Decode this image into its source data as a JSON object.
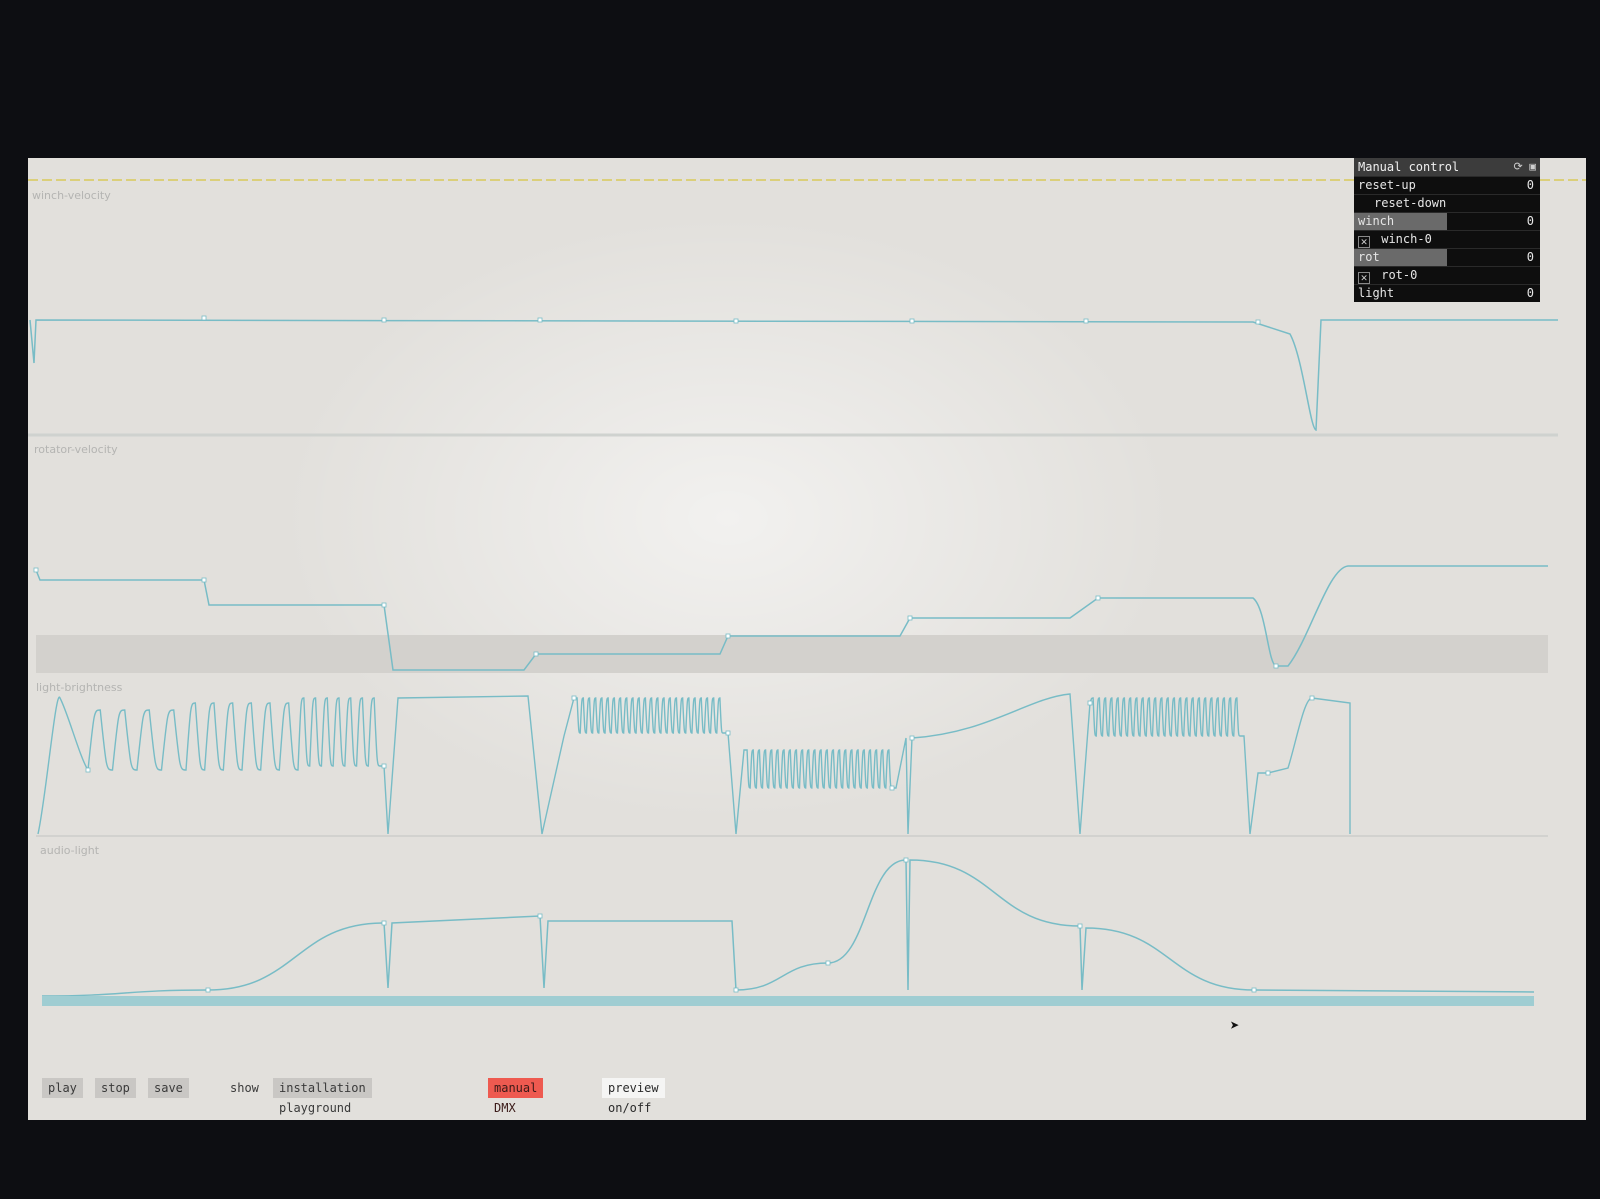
{
  "tracks": [
    {
      "id": "winch",
      "label": "winch-velocity"
    },
    {
      "id": "rotator",
      "label": "rotator-velocity"
    },
    {
      "id": "light",
      "label": "light-brightness"
    },
    {
      "id": "audio",
      "label": "audio-light"
    }
  ],
  "manual_control": {
    "title": "Manual control",
    "rows": [
      {
        "label": "reset-up",
        "value": "0",
        "type": "slider",
        "level": 0
      },
      {
        "label": "reset-down",
        "type": "button"
      },
      {
        "label": "winch",
        "value": "0",
        "type": "slider",
        "level": 0.5
      },
      {
        "label": "winch-0",
        "type": "checkbox",
        "checked": true
      },
      {
        "label": "rot",
        "value": "0",
        "type": "slider",
        "level": 0.5
      },
      {
        "label": "rot-0",
        "type": "checkbox",
        "checked": true
      },
      {
        "label": "light",
        "value": "0",
        "type": "slider",
        "level": 0
      }
    ]
  },
  "bottom_bar": {
    "play": "play",
    "stop": "stop",
    "save": "save",
    "show": "show",
    "installation_playground": "installation playground",
    "manual_dmx": "manual DMX (m)",
    "preview": "preview on/off (p)"
  },
  "colors": {
    "curve": "#78bcc6",
    "background": "#e2e0dc",
    "panel": "#101010",
    "manual_dmx_active": "#ee5a50"
  }
}
